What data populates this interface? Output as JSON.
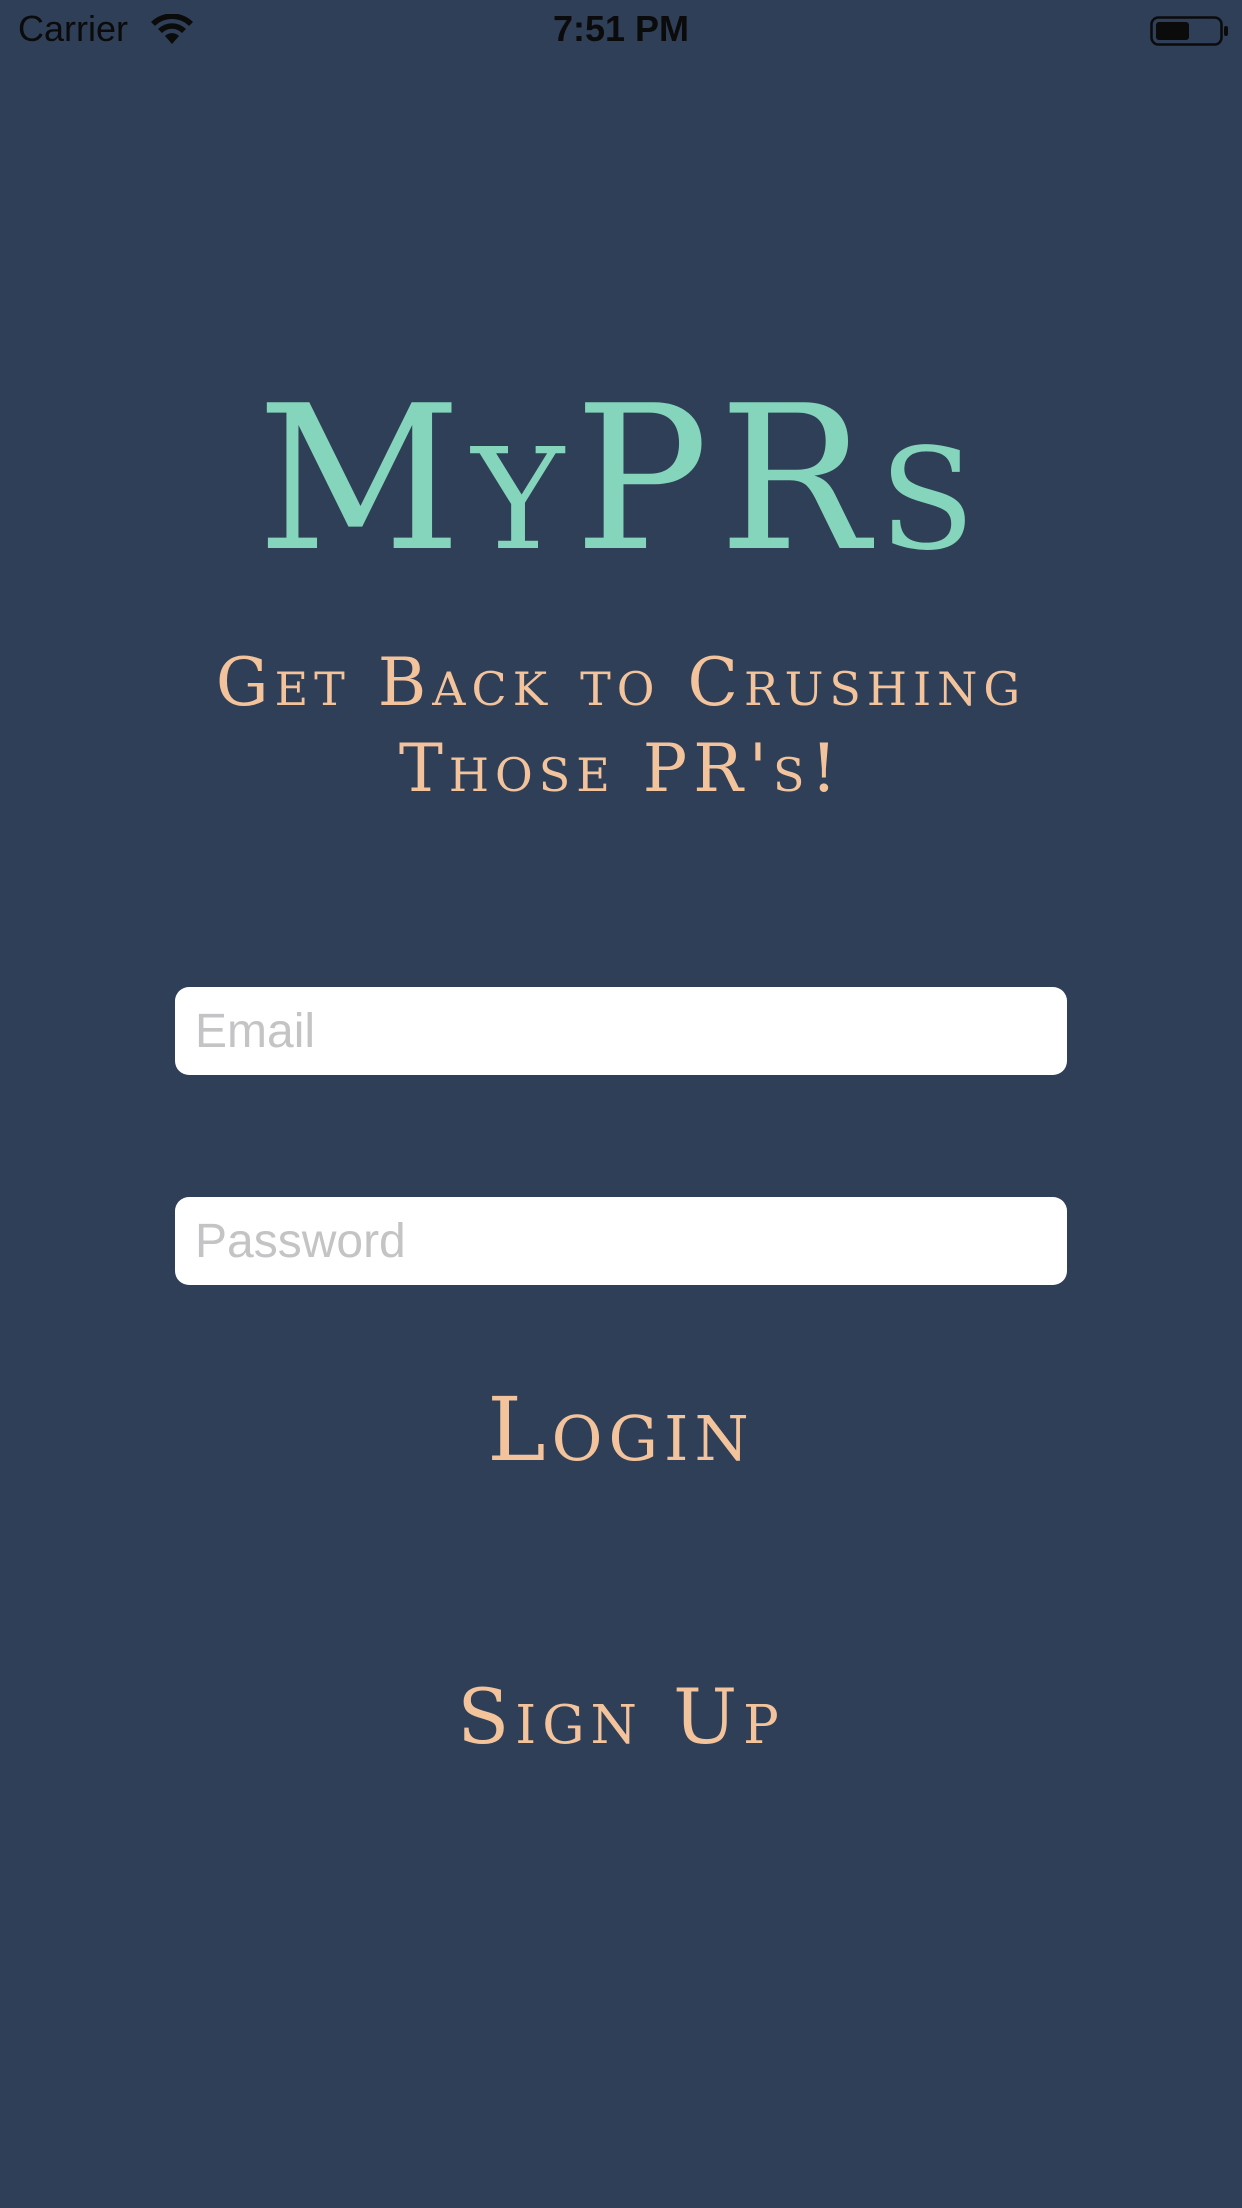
{
  "status_bar": {
    "carrier": "Carrier",
    "time": "7:51 PM"
  },
  "app": {
    "title": "MyPRs",
    "tagline": "Get Back to Crushing Those PR's!"
  },
  "form": {
    "email_placeholder": "Email",
    "email_value": "",
    "password_placeholder": "Password",
    "password_value": "",
    "login_label": "Login",
    "signup_label": "Sign Up"
  },
  "colors": {
    "background": "#2f3f58",
    "title": "#84d5bb",
    "accent": "#f3c39c"
  },
  "icons": {
    "wifi": "wifi-icon",
    "battery": "battery-icon"
  }
}
